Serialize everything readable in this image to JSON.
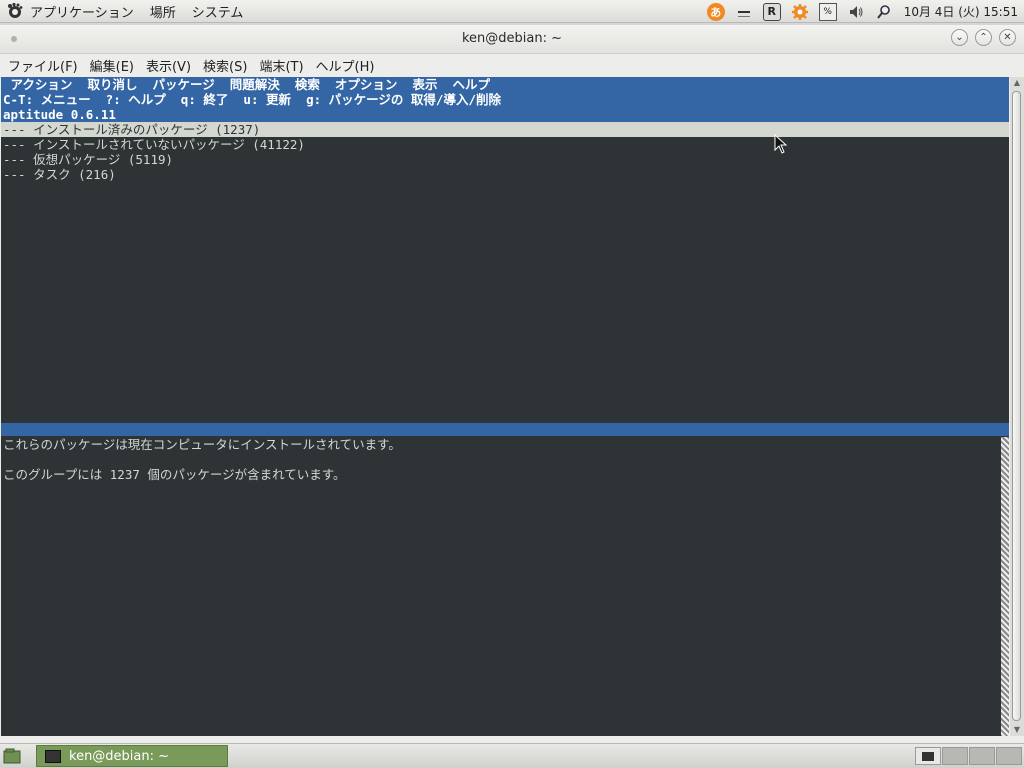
{
  "top_panel": {
    "menus": [
      "アプリケーション",
      "場所",
      "システム"
    ],
    "tray_icons": [
      "input-method-icon",
      "window-list-icon",
      "r-icon",
      "gear-icon",
      "keyboard-icon",
      "volume-icon",
      "search-icon"
    ],
    "tray_labels": {
      "ime": "あ",
      "r": "R",
      "kbd": "%"
    },
    "clock": "10月 4日 (火) 15:51"
  },
  "window": {
    "title": "ken@debian: ~",
    "menubar": [
      "ファイル(F)",
      "編集(E)",
      "表示(V)",
      "検索(S)",
      "端末(T)",
      "ヘルプ(H)"
    ]
  },
  "terminal": {
    "aptitude_menu": " アクション  取り消し  パッケージ  問題解決  検索  オプション  表示  ヘルプ",
    "hint_line": "C-T: メニュー  ?: ヘルプ  q: 終了  u: 更新  g: パッケージの 取得/導入/削除",
    "version_line": "aptitude 0.6.11",
    "groups": [
      "--- インストール済みのパッケージ (1237)",
      "--- インストールされていないパッケージ (41122)",
      "--- 仮想パッケージ (5119)",
      "--- タスク (216)"
    ],
    "description": [
      "これらのパッケージは現在コンピュータにインストールされています。",
      "",
      "このグループには 1237 個のパッケージが含まれています。"
    ]
  },
  "taskbar": {
    "task_label": "ken@debian: ~",
    "workspaces": 4
  },
  "colors": {
    "terminal_bg": "#2e3436",
    "aptitude_blue": "#3465a4",
    "task_green": "#7a9a5a"
  }
}
